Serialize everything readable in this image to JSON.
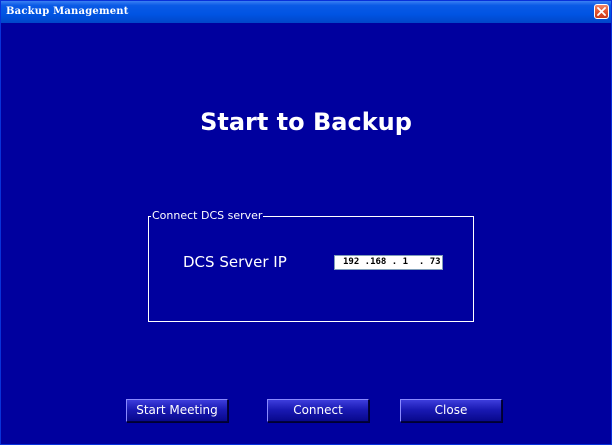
{
  "window": {
    "title": "Backup Management"
  },
  "main": {
    "heading": "Start to Backup"
  },
  "group": {
    "legend": "Connect DCS server",
    "ip_label": "DCS Server IP",
    "ip_value": "192 .168 . 1  . 73"
  },
  "buttons": {
    "start_meeting": "Start Meeting",
    "connect": "Connect",
    "close": "Close"
  },
  "colors": {
    "background": "#00009e",
    "titlebar": "#0054e3",
    "close_button": "#e2542f"
  },
  "icons": {
    "close": "close-x-icon"
  }
}
